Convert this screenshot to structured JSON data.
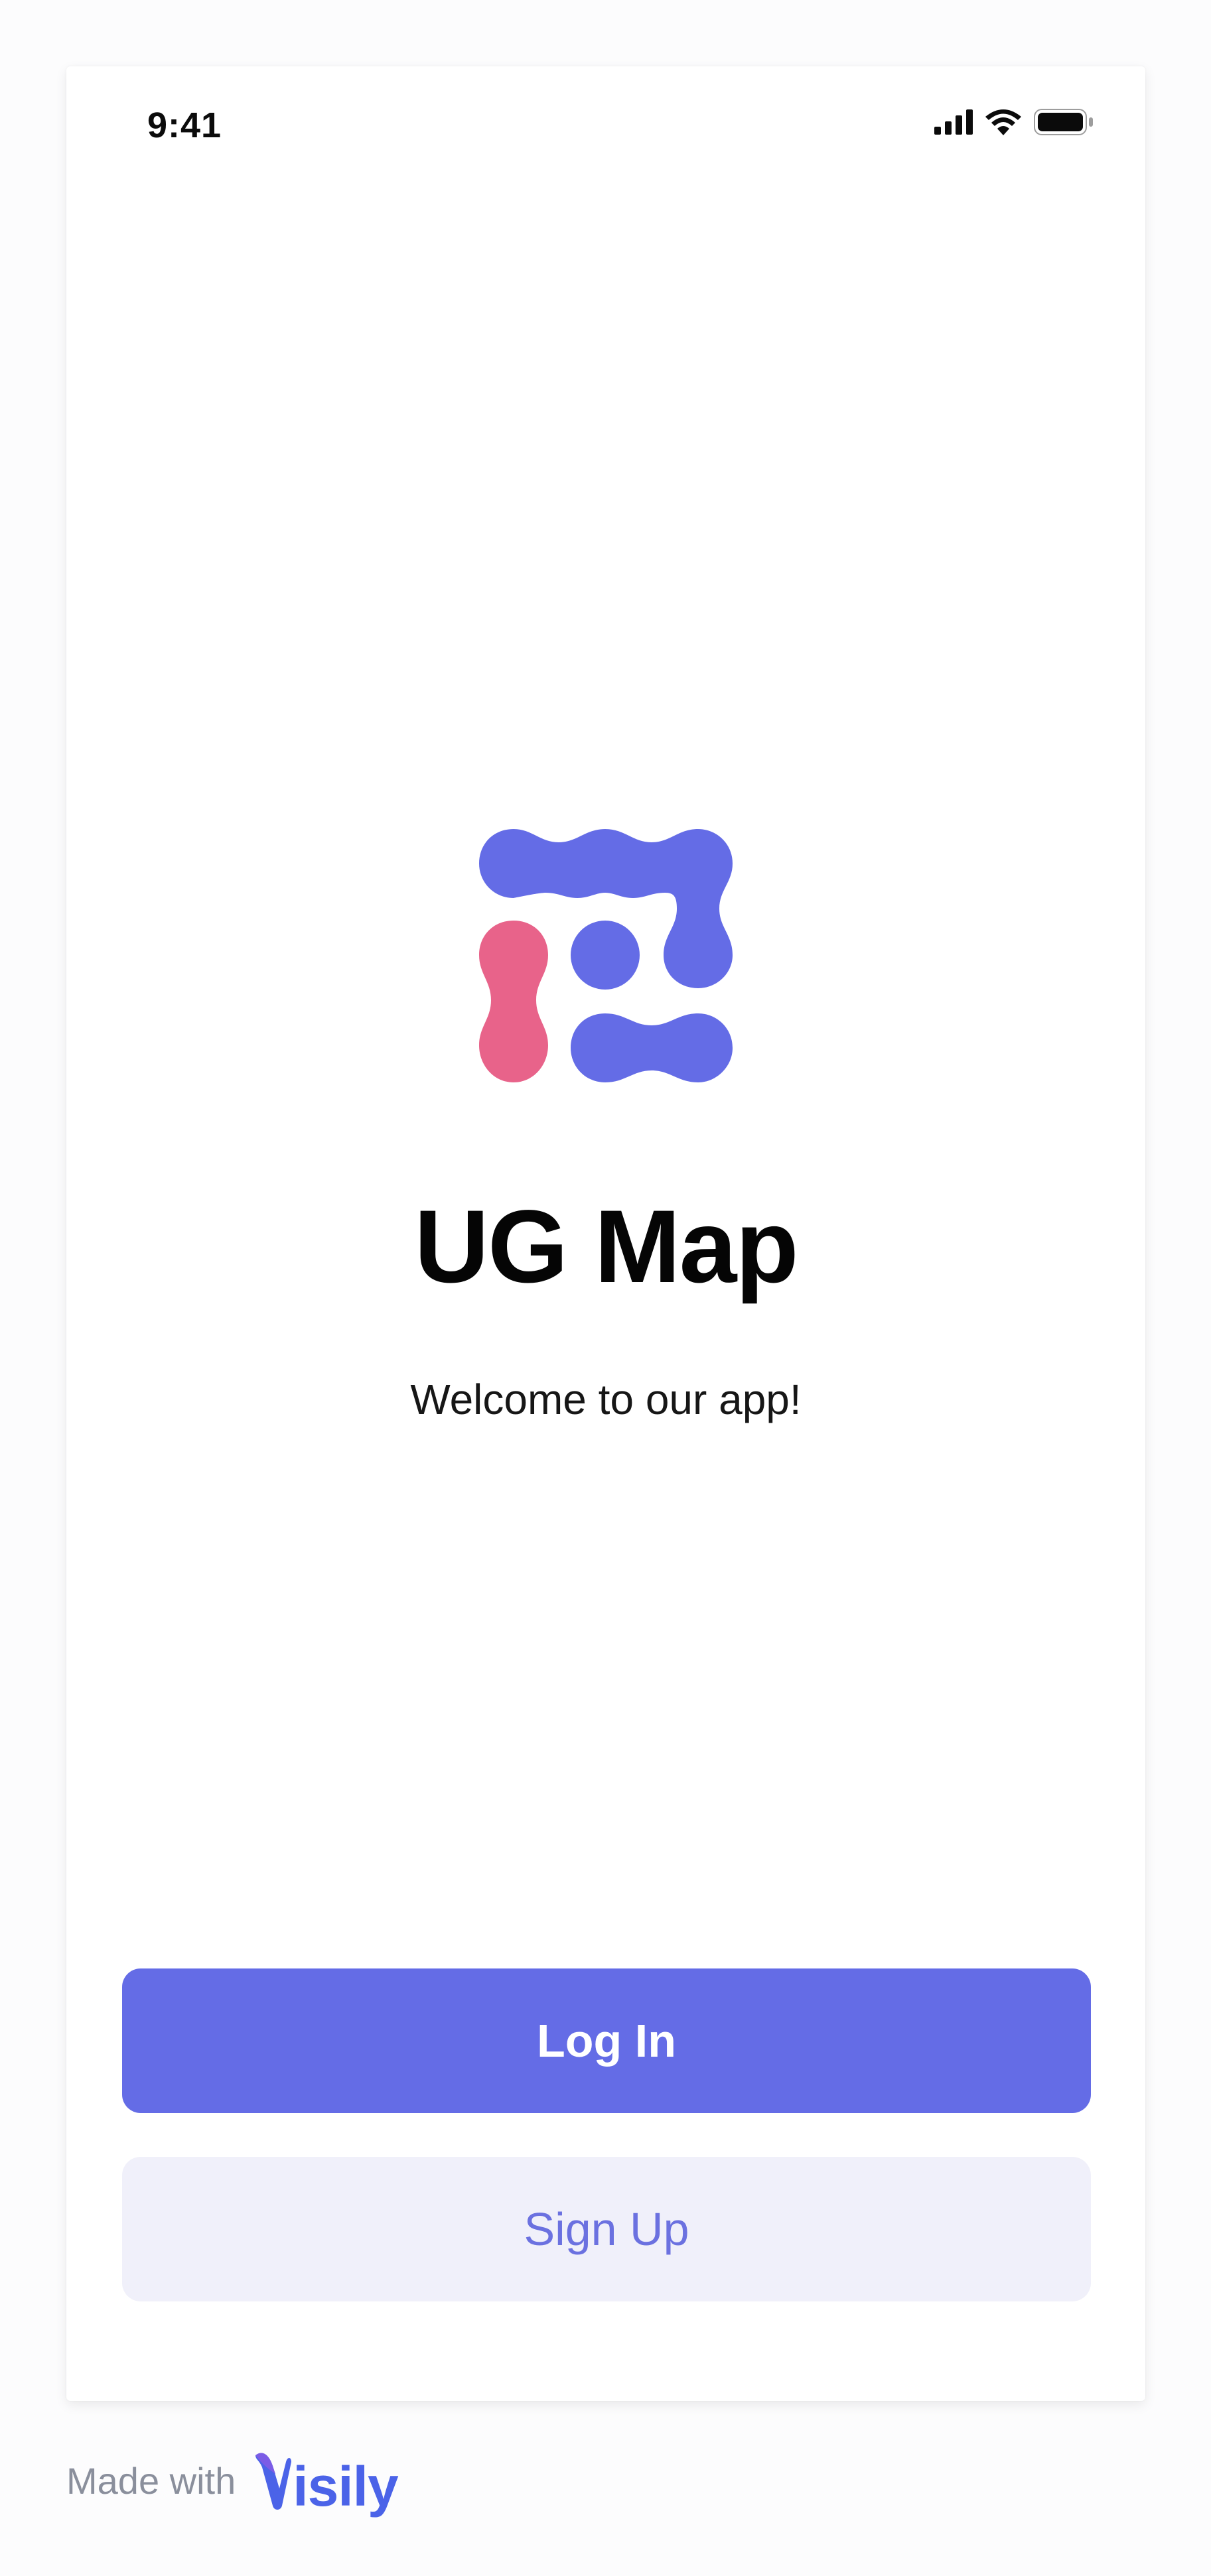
{
  "status_bar": {
    "time": "9:41"
  },
  "app": {
    "title": "UG Map",
    "tagline": "Welcome to our app!"
  },
  "actions": {
    "login_label": "Log In",
    "signup_label": "Sign Up"
  },
  "footer": {
    "made_with": "Made with",
    "brand": "isily",
    "brand_full": "Visily"
  },
  "colors": {
    "accent": "#646ce6",
    "logo_primary": "#646ce6",
    "logo_secondary": "#e8638a",
    "secondary_button_bg": "#f0f0fa",
    "secondary_button_text": "#6b71e0",
    "brand": "#4b63e8"
  },
  "icons": [
    "signal-icon",
    "wifi-icon",
    "battery-icon",
    "app-logo-icon",
    "visily-logo-icon"
  ]
}
